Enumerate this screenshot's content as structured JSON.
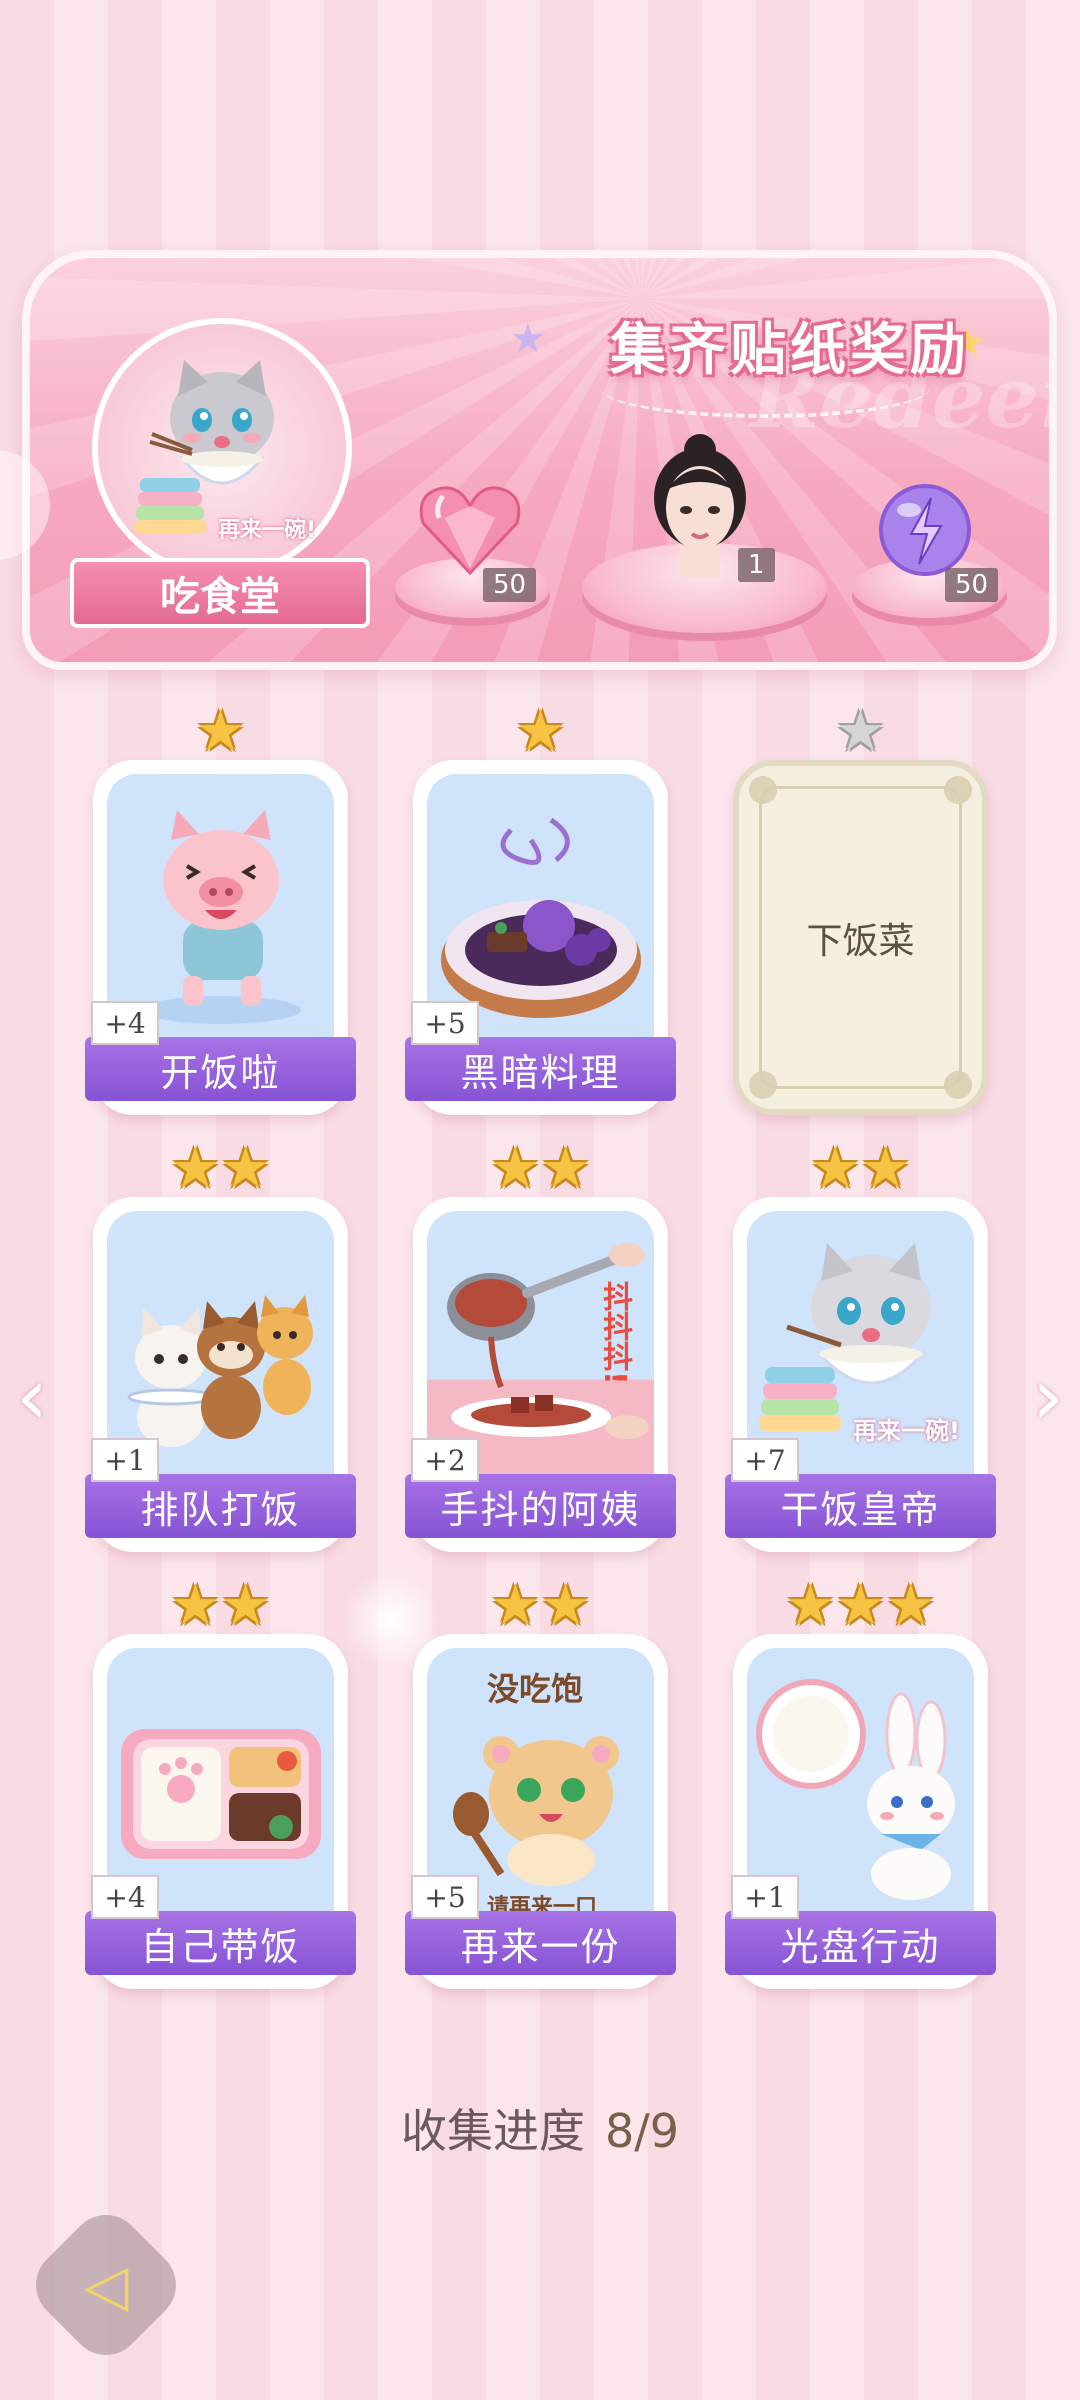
{
  "banner": {
    "title": "集齐贴纸奖励",
    "watermark": "Redeem",
    "shop_name": "吃食堂",
    "emblem_caption": "再来一碗!",
    "rewards": [
      {
        "icon": "heart-gem-icon",
        "count": "50"
      },
      {
        "icon": "avatar-portrait-icon",
        "count": "1"
      },
      {
        "icon": "energy-orb-icon",
        "count": "50"
      }
    ]
  },
  "cards": [
    {
      "title": "开饭啦",
      "bonus": "+4",
      "stars": 1,
      "locked": false,
      "scene": "pig-running"
    },
    {
      "title": "黑暗料理",
      "bonus": "+5",
      "stars": 1,
      "locked": false,
      "scene": "dark-dish"
    },
    {
      "title": "下饭菜",
      "bonus": "",
      "stars": 1,
      "locked": true,
      "scene": "locked"
    },
    {
      "title": "排队打饭",
      "bonus": "+1",
      "stars": 2,
      "locked": false,
      "scene": "animals-queue"
    },
    {
      "title": "手抖的阿姨",
      "bonus": "+2",
      "stars": 2,
      "locked": false,
      "scene": "shaky-ladle",
      "caption": "抖抖抖!"
    },
    {
      "title": "干饭皇帝",
      "bonus": "+7",
      "stars": 2,
      "locked": false,
      "scene": "cat-eating",
      "caption": "再来一碗!"
    },
    {
      "title": "自己带饭",
      "bonus": "+4",
      "stars": 2,
      "locked": false,
      "scene": "bento-box"
    },
    {
      "title": "再来一份",
      "bonus": "+5",
      "stars": 2,
      "locked": false,
      "scene": "hamster-spoon",
      "caption_top": "没吃饱",
      "caption": "请再来一口"
    },
    {
      "title": "光盘行动",
      "bonus": "+1",
      "stars": 3,
      "locked": false,
      "scene": "bunny-plate"
    }
  ],
  "progress": {
    "label": "收集进度",
    "value": "8/9"
  },
  "colors": {
    "accent": "#8653d4",
    "star": "#f6c343",
    "banner": "#f6a9bf"
  }
}
